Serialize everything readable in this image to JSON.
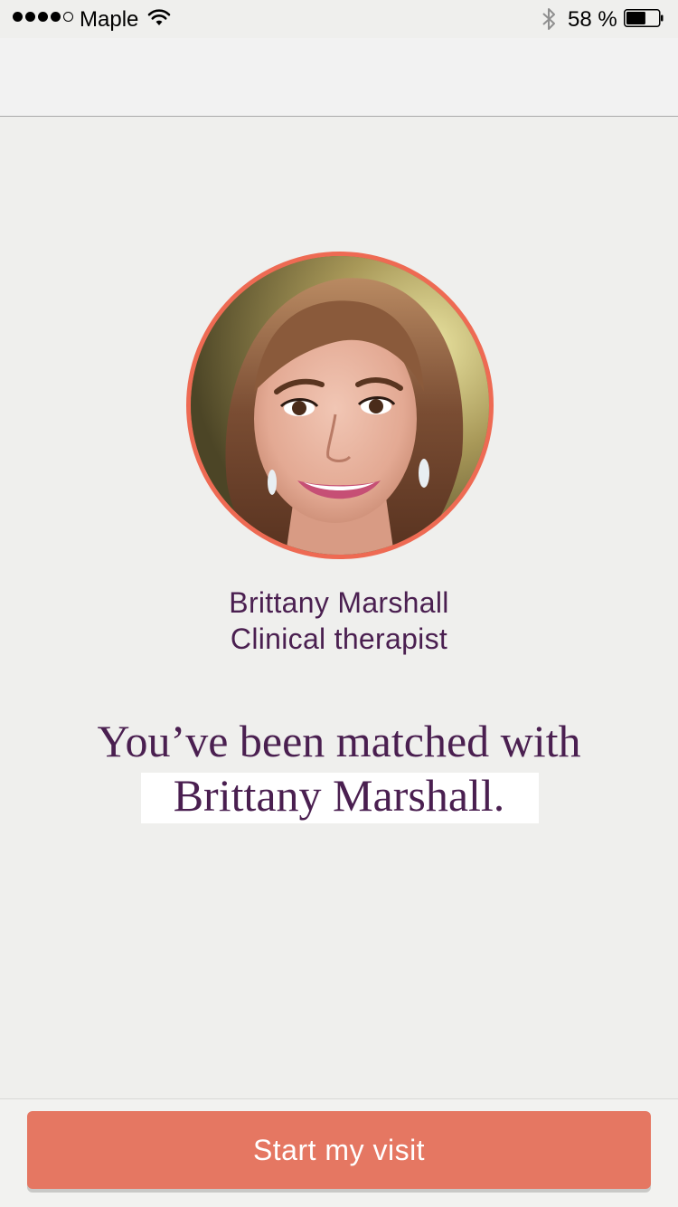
{
  "status_bar": {
    "carrier": "Maple",
    "battery_percent_text": "58 %",
    "battery_level": 0.58,
    "signal_bars_filled": 4,
    "signal_bars_total": 5,
    "icons": [
      "wifi-icon",
      "bluetooth-icon",
      "battery-icon"
    ]
  },
  "provider": {
    "name": "Brittany Marshall",
    "role": "Clinical therapist"
  },
  "match": {
    "line1": "You’ve been matched with",
    "line2": "Brittany Marshall."
  },
  "cta": {
    "label": "Start my visit"
  },
  "colors": {
    "accent": "#e57762",
    "avatar_ring": "#ee6a53",
    "text_primary": "#4a1f50",
    "background": "#efefed"
  }
}
